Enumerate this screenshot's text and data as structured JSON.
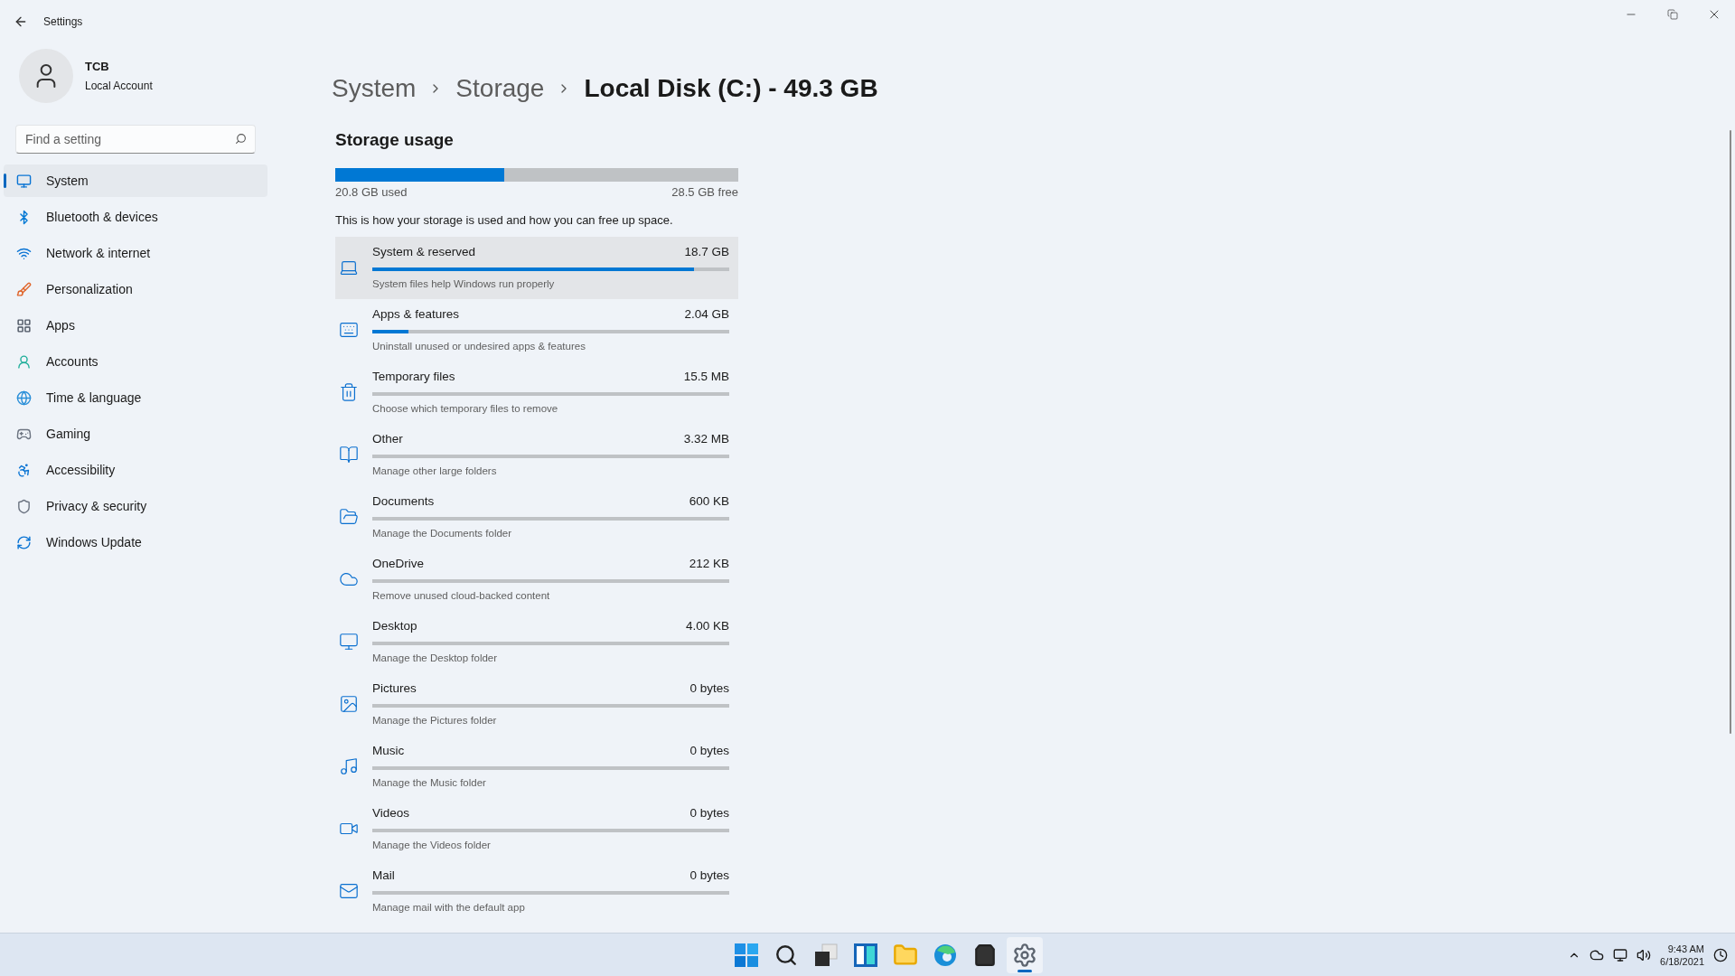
{
  "window": {
    "title": "Settings"
  },
  "account": {
    "name": "TCB",
    "type": "Local Account"
  },
  "search": {
    "placeholder": "Find a setting"
  },
  "sidebar": {
    "items": [
      {
        "label": "System",
        "selected": true
      },
      {
        "label": "Bluetooth & devices",
        "selected": false
      },
      {
        "label": "Network & internet",
        "selected": false
      },
      {
        "label": "Personalization",
        "selected": false
      },
      {
        "label": "Apps",
        "selected": false
      },
      {
        "label": "Accounts",
        "selected": false
      },
      {
        "label": "Time & language",
        "selected": false
      },
      {
        "label": "Gaming",
        "selected": false
      },
      {
        "label": "Accessibility",
        "selected": false
      },
      {
        "label": "Privacy & security",
        "selected": false
      },
      {
        "label": "Windows Update",
        "selected": false
      }
    ]
  },
  "breadcrumb": [
    "System",
    "Storage",
    "Local Disk (C:) - 49.3 GB"
  ],
  "storage_usage": {
    "title": "Storage usage",
    "level": 0.42,
    "used": "20.8 GB used",
    "free": "28.5 GB free",
    "description": "This is how your storage is used and how you can free up space."
  },
  "categories": [
    {
      "name": "System & reserved",
      "size": "18.7 GB",
      "description": "System files help Windows run properly",
      "level": 0.9,
      "selected": true
    },
    {
      "name": "Apps & features",
      "size": "2.04 GB",
      "description": "Uninstall unused or undesired apps & features",
      "level": 0.1,
      "selected": false
    },
    {
      "name": "Temporary files",
      "size": "15.5 MB",
      "description": "Choose which temporary files to remove",
      "selected": false
    },
    {
      "name": "Other",
      "size": "3.32 MB",
      "description": "Manage other large folders",
      "selected": false
    },
    {
      "name": "Documents",
      "size": "600 KB",
      "description": "Manage the Documents folder",
      "selected": false
    },
    {
      "name": "OneDrive",
      "size": "212 KB",
      "description": "Remove unused cloud-backed content",
      "selected": false
    },
    {
      "name": "Desktop",
      "size": "4.00 KB",
      "description": "Manage the Desktop folder",
      "selected": false
    },
    {
      "name": "Pictures",
      "size": "0 bytes",
      "description": "Manage the Pictures folder",
      "selected": false
    },
    {
      "name": "Music",
      "size": "0 bytes",
      "description": "Manage the Music folder",
      "selected": false
    },
    {
      "name": "Videos",
      "size": "0 bytes",
      "description": "Manage the Videos folder",
      "selected": false
    },
    {
      "name": "Mail",
      "size": "0 bytes",
      "description": "Manage mail with the default app",
      "selected": false
    }
  ],
  "taskbar": {
    "apps": [
      {
        "selected": false
      },
      {
        "selected": false
      },
      {
        "selected": false
      },
      {
        "selected": false
      },
      {
        "selected": false
      },
      {
        "selected": false
      },
      {
        "selected": false
      },
      {
        "selected": true
      }
    ],
    "time": "9:43 AM",
    "date": "6/18/2021"
  }
}
